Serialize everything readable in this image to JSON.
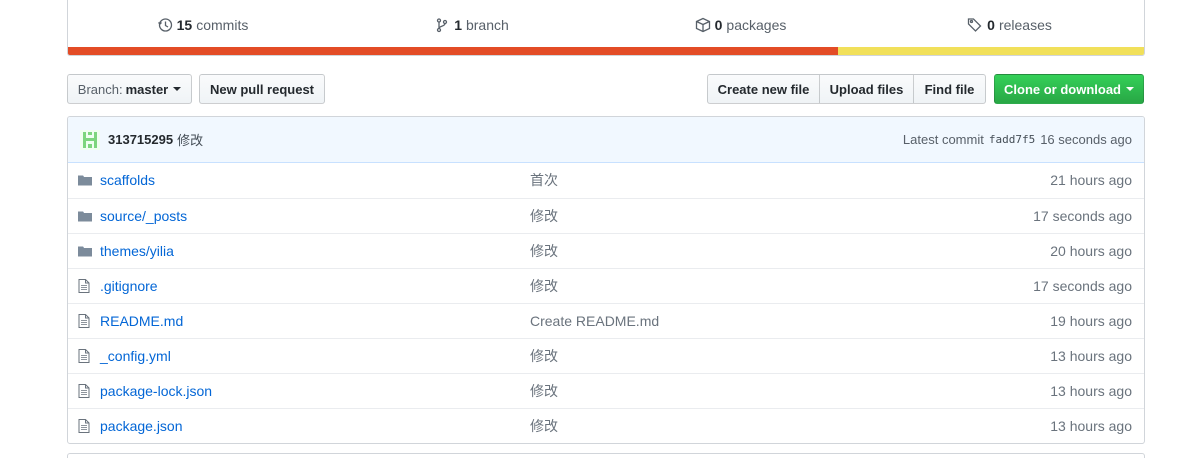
{
  "summary": {
    "commits": {
      "num": "15",
      "label": "commits"
    },
    "branches": {
      "num": "1",
      "label": "branch"
    },
    "packages": {
      "num": "0",
      "label": "packages"
    },
    "releases": {
      "num": "0",
      "label": "releases"
    }
  },
  "languages": [
    {
      "color": "#e34c26",
      "percent": 71.6
    },
    {
      "color": "#f1e05a",
      "percent": 28.4
    }
  ],
  "toolbar": {
    "branch_prefix": "Branch:",
    "branch_name": "master",
    "new_pr": "New pull request",
    "create_file": "Create new file",
    "upload_files": "Upload files",
    "find_file": "Find file",
    "clone": "Clone or download"
  },
  "commit": {
    "author": "313715295",
    "message": "修改",
    "latest_label": "Latest commit",
    "sha": "fadd7f5",
    "age": "16 seconds ago"
  },
  "files": [
    {
      "type": "dir",
      "name": "scaffolds",
      "message": "首次",
      "age": "21 hours ago"
    },
    {
      "type": "dir",
      "name": "source/_posts",
      "message": "修改",
      "age": "17 seconds ago"
    },
    {
      "type": "dir",
      "name": "themes/yilia",
      "message": "修改",
      "age": "20 hours ago"
    },
    {
      "type": "file",
      "name": ".gitignore",
      "message": "修改",
      "age": "17 seconds ago"
    },
    {
      "type": "file",
      "name": "README.md",
      "message": "Create README.md",
      "age": "19 hours ago"
    },
    {
      "type": "file",
      "name": "_config.yml",
      "message": "修改",
      "age": "13 hours ago"
    },
    {
      "type": "file",
      "name": "package-lock.json",
      "message": "修改",
      "age": "13 hours ago"
    },
    {
      "type": "file",
      "name": "package.json",
      "message": "修改",
      "age": "13 hours ago"
    }
  ]
}
